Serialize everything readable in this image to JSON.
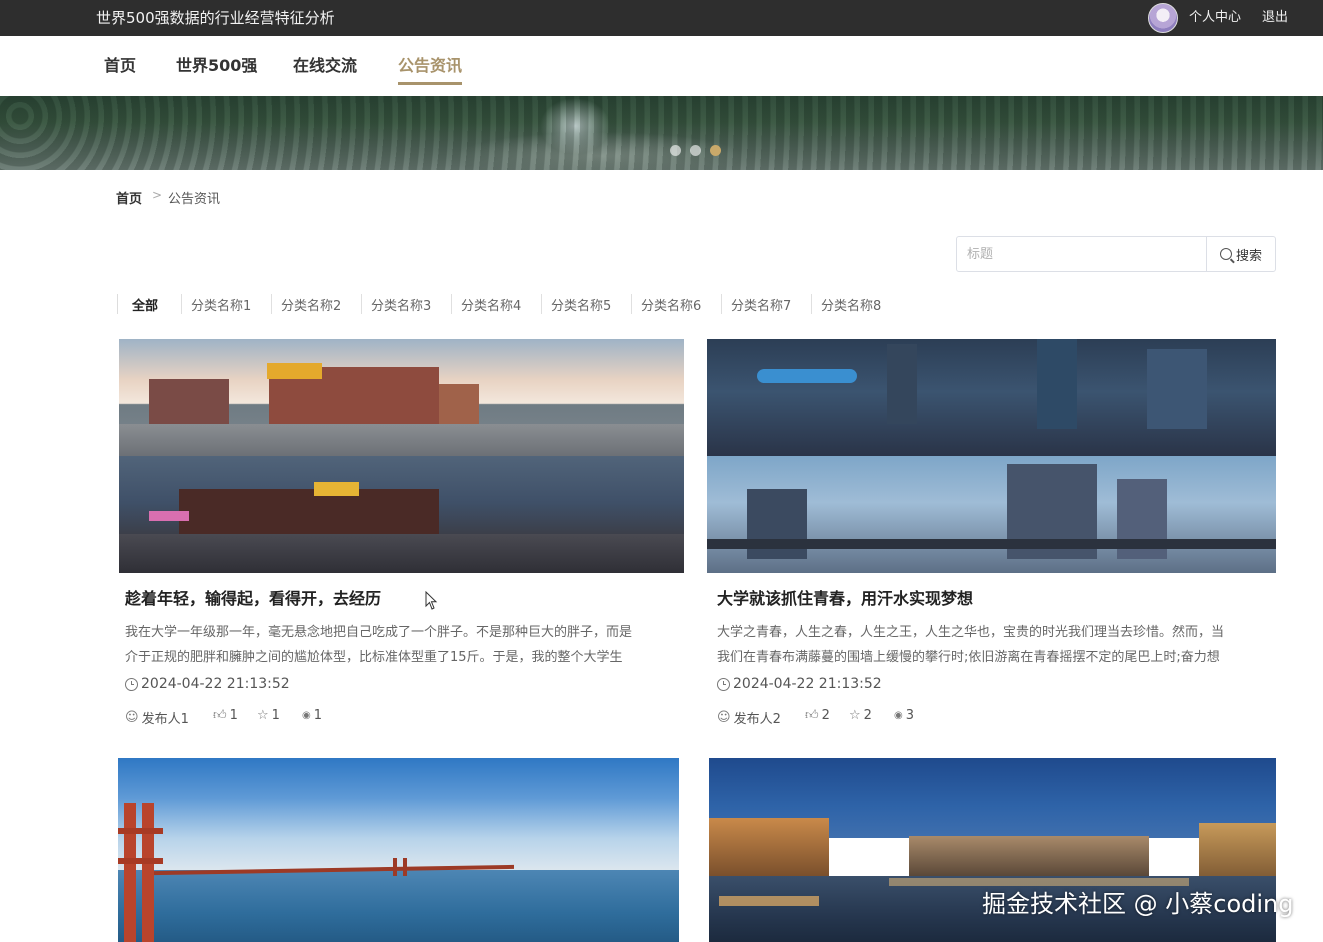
{
  "header": {
    "title": "世界500强数据的行业经营特征分析",
    "user_center": "个人中心",
    "logout": "退出"
  },
  "nav": {
    "items": [
      {
        "label": "首页"
      },
      {
        "label": "世界500强"
      },
      {
        "label": "在线交流"
      },
      {
        "label": "公告资讯",
        "active": true
      }
    ]
  },
  "banner": {
    "slide_count": 3,
    "active_slide": 3
  },
  "breadcrumb": {
    "home": "首页",
    "separator": ">",
    "current": "公告资讯"
  },
  "search": {
    "placeholder": "标题",
    "button_label": "搜索"
  },
  "categories": [
    "全部",
    "分类名称1",
    "分类名称2",
    "分类名称3",
    "分类名称4",
    "分类名称5",
    "分类名称6",
    "分类名称7",
    "分类名称8"
  ],
  "articles": [
    {
      "title": "趁着年轻，输得起，看得开，去经历",
      "desc_line1": "我在大学一年级那一年，毫无悬念地把自己吃成了一个胖子。不是那种巨大的胖子，而是",
      "desc_line2": "介于正规的肥胖和臃肿之间的尴尬体型，比标准体型重了15斤。于是，我的整个大学生",
      "date": "2024-04-22 21:13:52",
      "author": "发布人1",
      "likes": "1",
      "favorites": "1",
      "views": "1"
    },
    {
      "title": "大学就该抓住青春，用汗水实现梦想",
      "desc_line1": "大学之青春，人生之春，人生之王，人生之华也，宝贵的时光我们理当去珍惜。然而，当",
      "desc_line2": "我们在青春布满藤蔓的围墙上缓慢的攀行时;依旧游离在青春摇摆不定的尾巴上时;奋力想",
      "date": "2024-04-22 21:13:52",
      "author": "发布人2",
      "likes": "2",
      "favorites": "2",
      "views": "3"
    }
  ],
  "watermark": "掘金技术社区 @ 小蔡coding",
  "colors": {
    "topbar": "#2e2e2e",
    "accent": "#a8936b",
    "active_dot": "#c9a96a"
  }
}
